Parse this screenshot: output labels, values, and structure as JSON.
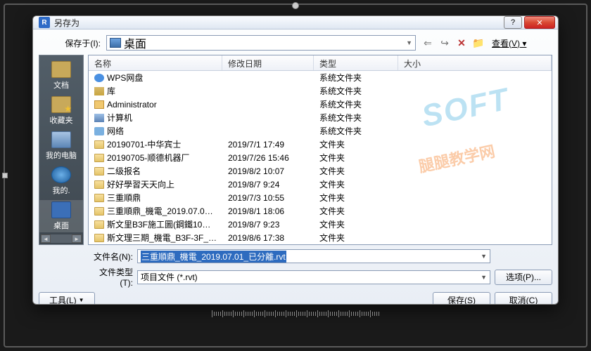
{
  "window": {
    "app_letter": "R",
    "title": "另存为",
    "help_symbol": "?",
    "close_symbol": "✕"
  },
  "locbar": {
    "label": "保存于(I):",
    "value": "桌面"
  },
  "toolbar": {
    "back_icon": "⇐",
    "up_icon": "↪",
    "delete_icon": "✕",
    "new_folder_icon": "📁",
    "view_label": "查看(V)"
  },
  "sidebar": {
    "items": [
      {
        "label": "文档",
        "kind": "folder"
      },
      {
        "label": "收藏夹",
        "kind": "fav"
      },
      {
        "label": "我的电脑",
        "kind": "comp"
      },
      {
        "label": "我的.",
        "kind": "globe"
      },
      {
        "label": "桌面",
        "kind": "desk",
        "selected": true
      }
    ]
  },
  "columns": {
    "name": "名称",
    "date": "修改日期",
    "type": "类型",
    "size": "大小"
  },
  "rows": [
    {
      "icon": "cloud",
      "name": "WPS网盘",
      "date": "",
      "type": "系统文件夹"
    },
    {
      "icon": "lib",
      "name": "库",
      "date": "",
      "type": "系统文件夹"
    },
    {
      "icon": "user",
      "name": "Administrator",
      "date": "",
      "type": "系统文件夹"
    },
    {
      "icon": "comp",
      "name": "计算机",
      "date": "",
      "type": "系统文件夹"
    },
    {
      "icon": "net",
      "name": "网络",
      "date": "",
      "type": "系统文件夹"
    },
    {
      "icon": "folder",
      "name": "20190701-中华宾士",
      "date": "2019/7/1 17:49",
      "type": "文件夹"
    },
    {
      "icon": "folder",
      "name": "20190705-顺德机器厂",
      "date": "2019/7/26 15:46",
      "type": "文件夹"
    },
    {
      "icon": "folder",
      "name": "二级报名",
      "date": "2019/8/2 10:07",
      "type": "文件夹"
    },
    {
      "icon": "folder",
      "name": "好好學習天天向上",
      "date": "2019/8/7 9:24",
      "type": "文件夹"
    },
    {
      "icon": "folder",
      "name": "三重順鼎",
      "date": "2019/7/3 10:55",
      "type": "文件夹"
    },
    {
      "icon": "folder",
      "name": "三重順鼎_機電_2019.07.0…",
      "date": "2019/8/1 18:06",
      "type": "文件夹"
    },
    {
      "icon": "folder",
      "name": "斯文里B3F施工圖(鋼鐵10…",
      "date": "2019/8/7 9:23",
      "type": "文件夹"
    },
    {
      "icon": "folder",
      "name": "斯文理三期_機電_B3F-3F_…",
      "date": "2019/8/6 17:38",
      "type": "文件夹"
    }
  ],
  "filename": {
    "label": "文件名(N):",
    "value": "三重順鼎_機電_2019.07.01_已分離.rvt"
  },
  "filetype": {
    "label": "文件类型(T):",
    "value": "项目文件 (*.rvt)"
  },
  "buttons": {
    "tools": "工具(L)",
    "options": "选项(P)...",
    "save": "保存(S)",
    "cancel": "取消(C)"
  },
  "watermark": {
    "main": "SOFT",
    "sub": "腿腿教学网"
  }
}
